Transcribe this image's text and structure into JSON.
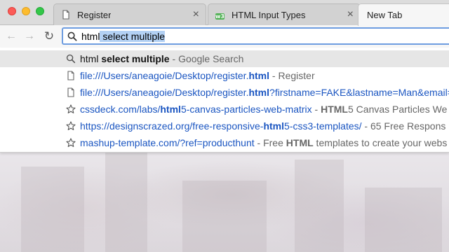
{
  "window_controls": {
    "close": "close",
    "minimize": "minimize",
    "zoom": "zoom"
  },
  "tabs": [
    {
      "title": "Register",
      "favicon": "document-icon",
      "close": "×",
      "active": false
    },
    {
      "title": "HTML Input Types",
      "favicon": "w3schools-icon",
      "favicon_text": "w3",
      "close": "×",
      "active": false
    },
    {
      "title": "New Tab",
      "favicon": "",
      "active": true
    }
  ],
  "toolbar": {
    "back": "←",
    "forward": "→",
    "reload": "↻",
    "omnibox": {
      "typed": "html",
      "completion": " select multiple"
    }
  },
  "suggestions": [
    {
      "icon": "search-icon",
      "query_plain": "html",
      "query_bold": " select multiple",
      "separator": " - ",
      "desc": "Google Search",
      "selected": true
    },
    {
      "icon": "document-icon",
      "url_pre": "file:///Users/aneagoie/Desktop/register.",
      "url_bold": "html",
      "url_post": "",
      "separator": " - ",
      "desc": "Register"
    },
    {
      "icon": "document-icon",
      "url_pre": "file:///Users/aneagoie/Desktop/register.",
      "url_bold": "html",
      "url_post": "?firstname=FAKE&lastname=Man&email=",
      "separator": "",
      "desc": ""
    },
    {
      "icon": "star-icon",
      "url_pre": "cssdeck.com/labs/",
      "url_bold": "html",
      "url_post": "5-canvas-particles-web-matrix",
      "separator": " - ",
      "desc_bold": "HTML",
      "desc": "5 Canvas Particles We"
    },
    {
      "icon": "star-icon",
      "url_pre": "https://designscrazed.org/free-responsive-",
      "url_bold": "html",
      "url_post": "5-css3-templates/",
      "separator": " - ",
      "desc": "65 Free Respons"
    },
    {
      "icon": "star-icon",
      "url_pre": "mashup-template.com/?ref=producthunt",
      "url_bold": "",
      "url_post": "",
      "separator": " - ",
      "desc_pre": "Free ",
      "desc_bold": "HTML",
      "desc": " templates to create your webs"
    }
  ]
}
